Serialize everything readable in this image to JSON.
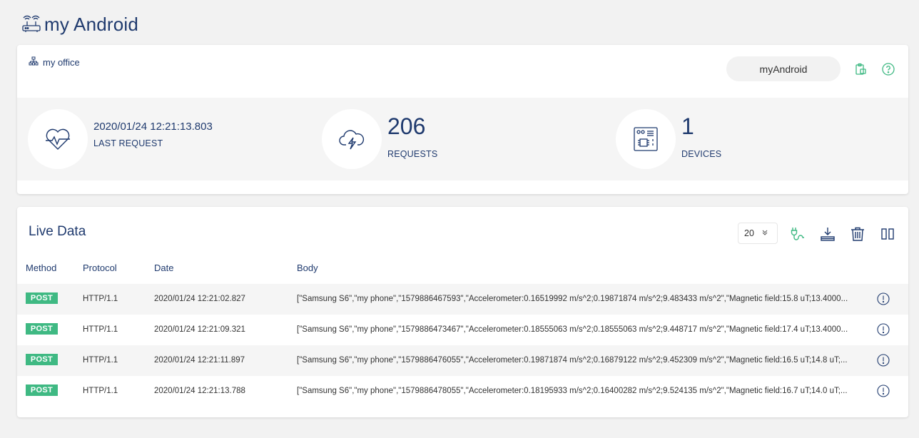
{
  "page": {
    "title": "my Android",
    "title_icon": "router-icon"
  },
  "summary": {
    "location": "my office",
    "location_icon": "network-icon",
    "device_name": "myAndroid",
    "actions": {
      "clipboard_icon": "clipboard-icon",
      "help_icon": "help-icon"
    },
    "stats": {
      "last_request": {
        "value": "2020/01/24 12:21:13.803",
        "label": "LAST REQUEST",
        "icon": "heartbeat-icon"
      },
      "requests": {
        "value": "206",
        "label": "REQUESTS",
        "icon": "cloud-lightning-icon"
      },
      "devices": {
        "value": "1",
        "label": "DEVICES",
        "icon": "device-chip-icon"
      }
    }
  },
  "live": {
    "title": "Live Data",
    "page_size": "20",
    "toolbar": [
      "plug-icon",
      "download-icon",
      "trash-icon",
      "columns-icon"
    ],
    "columns": {
      "method": "Method",
      "protocol": "Protocol",
      "date": "Date",
      "body": "Body"
    },
    "rows": [
      {
        "method": "POST",
        "protocol": "HTTP/1.1",
        "date": "2020/01/24 12:21:02.827",
        "body": "[\"Samsung S6\",\"my phone\",\"1579886467593\",\"Accelerometer:0.16519992 m/s^2;0.19871874 m/s^2;9.483433 m/s^2\",\"Magnetic field:15.8 uT;13.4000..."
      },
      {
        "method": "POST",
        "protocol": "HTTP/1.1",
        "date": "2020/01/24 12:21:09.321",
        "body": "[\"Samsung S6\",\"my phone\",\"1579886473467\",\"Accelerometer:0.18555063 m/s^2;0.18555063 m/s^2;9.448717 m/s^2\",\"Magnetic field:17.4 uT;13.4000..."
      },
      {
        "method": "POST",
        "protocol": "HTTP/1.1",
        "date": "2020/01/24 12:21:11.897",
        "body": "[\"Samsung S6\",\"my phone\",\"1579886476055\",\"Accelerometer:0.19871874 m/s^2;0.16879122 m/s^2;9.452309 m/s^2\",\"Magnetic field:16.5 uT;14.8 uT;..."
      },
      {
        "method": "POST",
        "protocol": "HTTP/1.1",
        "date": "2020/01/24 12:21:13.788",
        "body": "[\"Samsung S6\",\"my phone\",\"1579886478055\",\"Accelerometer:0.18195933 m/s^2;0.16400282 m/s^2;9.524135 m/s^2\",\"Magnetic field:16.7 uT;14.0 uT;..."
      }
    ]
  },
  "colors": {
    "brand": "#1f3a6e",
    "accent": "#3fb983",
    "background": "#f2f2f2"
  }
}
